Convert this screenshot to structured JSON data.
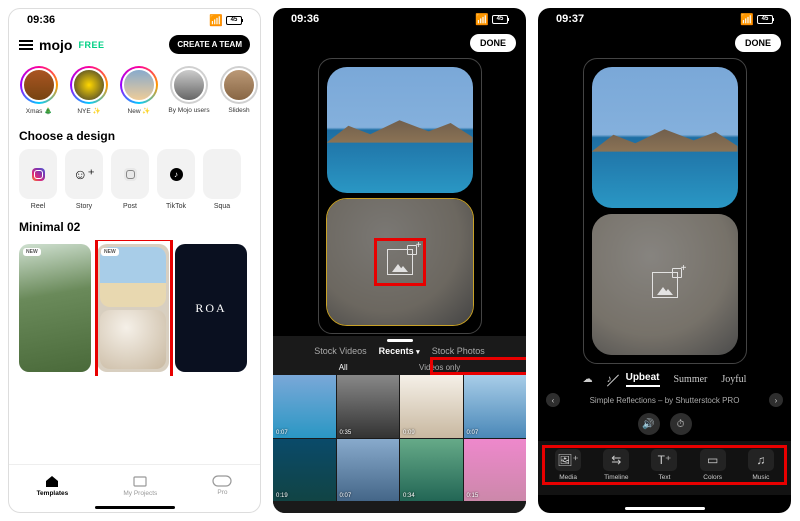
{
  "status": {
    "time1": "09:36",
    "time2": "09:36",
    "time3": "09:37",
    "batt": "45"
  },
  "s1": {
    "brand": "mojo",
    "free": "FREE",
    "cta": "CREATE A TEAM",
    "stories": [
      {
        "label": "Xmas 🎄"
      },
      {
        "label": "NYE ✨"
      },
      {
        "label": "New ✨"
      },
      {
        "label": "By Mojo users"
      },
      {
        "label": "Slidesh"
      }
    ],
    "choose_heading": "Choose a design",
    "designs": [
      {
        "label": "Reel"
      },
      {
        "label": "Story"
      },
      {
        "label": "Post"
      },
      {
        "label": "TikTok"
      },
      {
        "label": "Squa"
      }
    ],
    "section": "Minimal 02",
    "new_badge": "NEW",
    "roa": "ROA",
    "tabs": {
      "templates": "Templates",
      "projects": "My Projects",
      "pro": "Pro"
    }
  },
  "s2": {
    "done": "DONE",
    "picker_tabs": {
      "stock_videos": "Stock Videos",
      "recents": "Recents",
      "stock_photos": "Stock Photos"
    },
    "seg": {
      "all": "All",
      "videos_only": "Videos only"
    },
    "durations": [
      "0:07",
      "0:35",
      "0:09",
      "0:07",
      "0:19",
      "0:07",
      "0:34",
      "0:15"
    ]
  },
  "s3": {
    "done": "DONE",
    "music_tabs": {
      "upbeat": "Upbeat",
      "summer": "Summer",
      "joyful": "Joyful"
    },
    "track": "Simple Reflections – by Shutterstock PRO",
    "tools": {
      "media": "Media",
      "timeline": "Timeline",
      "text": "Text",
      "colors": "Colors",
      "music": "Music"
    }
  }
}
